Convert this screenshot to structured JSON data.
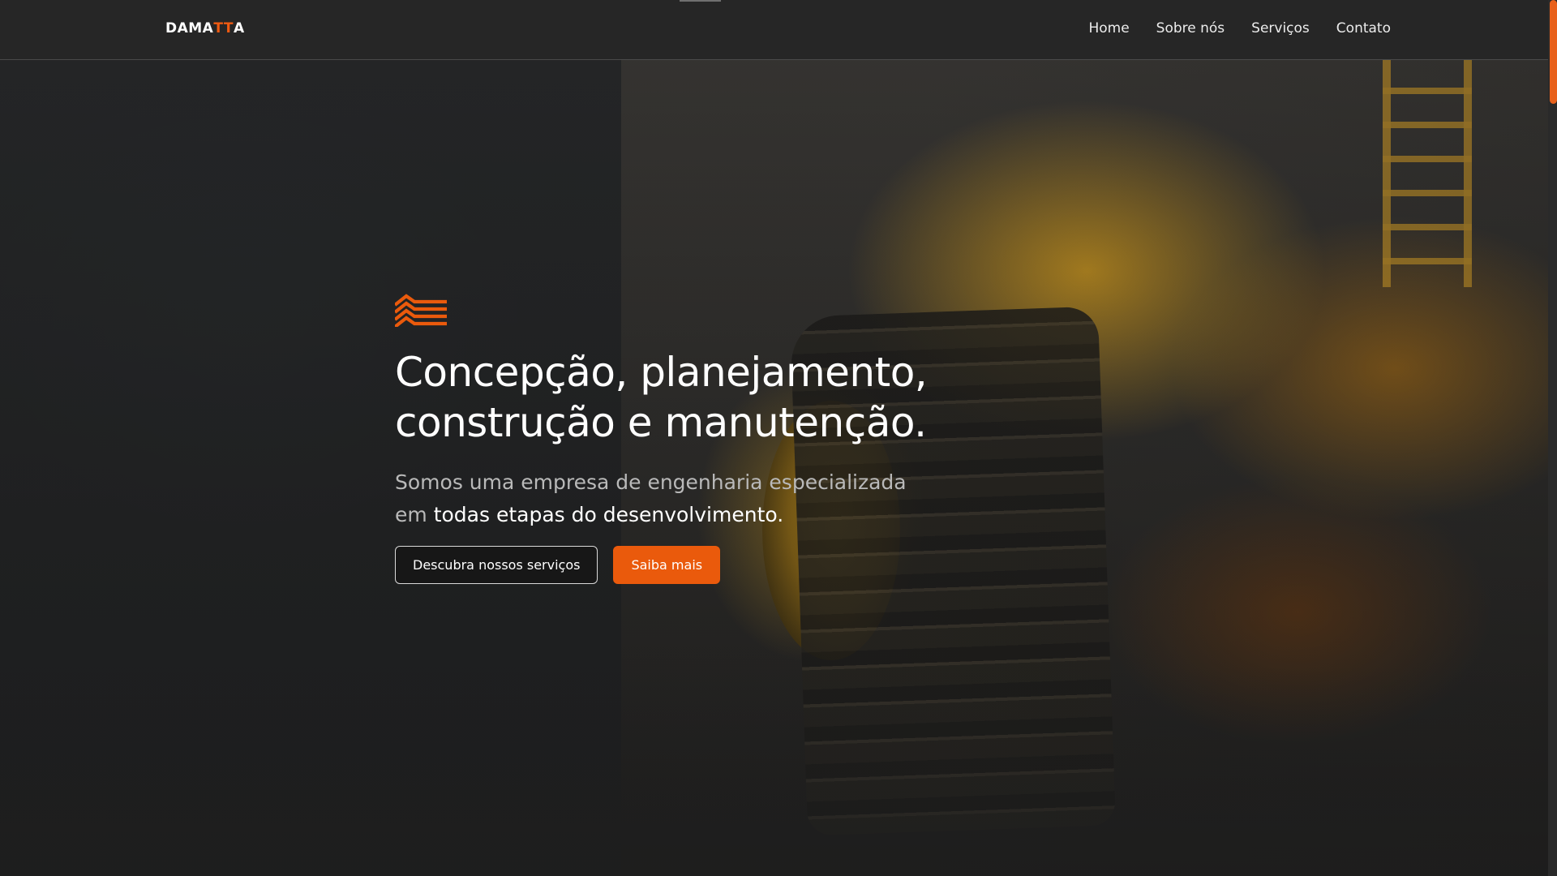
{
  "header": {
    "logo": {
      "part1": "DAMA",
      "part2": "TT",
      "part3": "A"
    },
    "nav": [
      {
        "label": "Home"
      },
      {
        "label": "Sobre nós"
      },
      {
        "label": "Serviços"
      },
      {
        "label": "Contato"
      }
    ]
  },
  "hero": {
    "icon": "layers-waves-icon",
    "title_line1": "Concepção, planejamento,",
    "title_line2": "construção e manutenção.",
    "subtitle_part1": "Somos uma empresa de engenharia especializada",
    "subtitle_part2": "em",
    "subtitle_part3": "todas etapas do desenvolvimento.",
    "primary_outline_button": "Descubra nossos serviços",
    "accent_button": "Saiba mais"
  },
  "colors": {
    "accent": "#ea5a0c",
    "header_bg": "#262626",
    "text": "#ffffff"
  }
}
